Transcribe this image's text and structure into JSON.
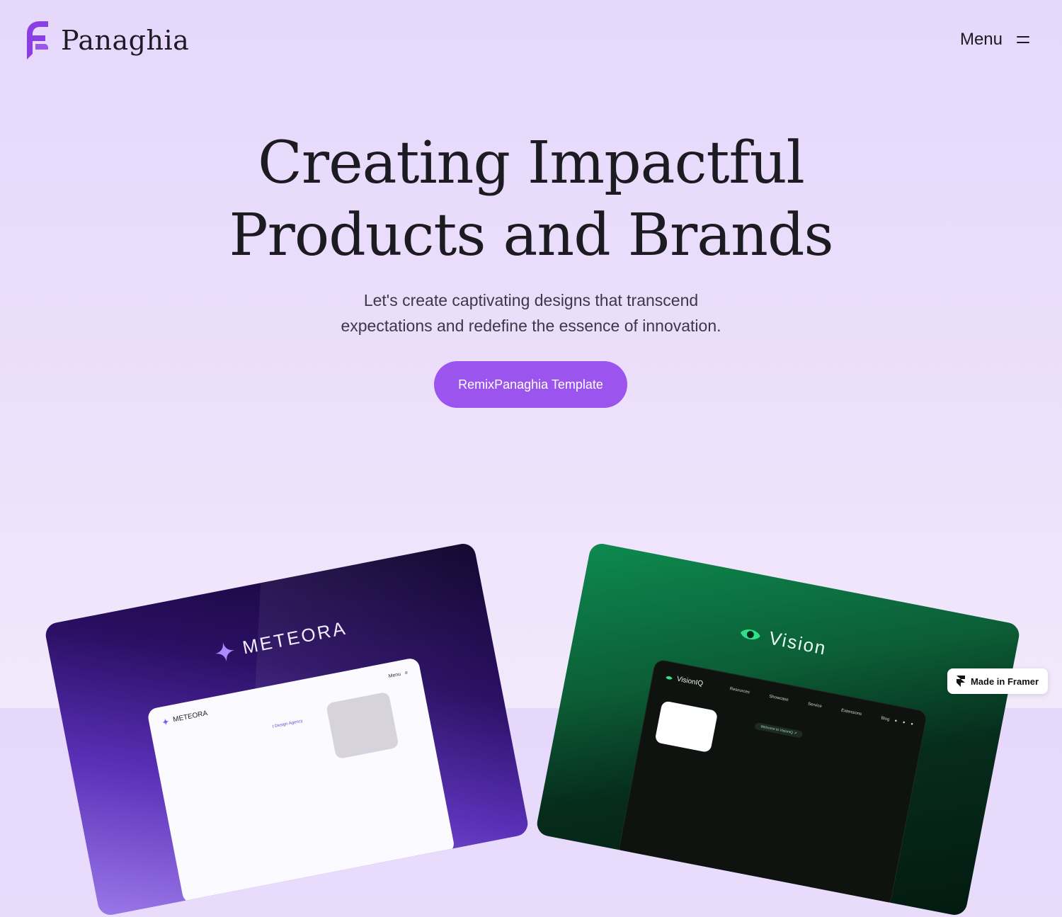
{
  "brand": {
    "name": "Panaghia",
    "accent": "#9b55ee",
    "logo_color": "#8b3fe0"
  },
  "header": {
    "menu_label": "Menu"
  },
  "hero": {
    "title_line1": "Creating Impactful",
    "title_line2": "Products and Brands",
    "subtitle_line1": "Let's create captivating designs that transcend",
    "subtitle_line2": "expectations and redefine the essence of innovation.",
    "cta_label": "RemixPanaghia Template"
  },
  "showcase": {
    "meteora": {
      "brand": "METEORA",
      "mini_logo": "METEORA",
      "mini_menu": "Menu",
      "mini_tagline": "t Design Agency"
    },
    "vision": {
      "brand": "Vision",
      "mini_logo": "VisionIQ",
      "nav": [
        "Resources",
        "Showcase",
        "Service",
        "Extensions",
        "Blog"
      ],
      "mini_pill": "Welcome to VisionIQ ↗"
    }
  },
  "badge": {
    "label": "Made in Framer"
  }
}
